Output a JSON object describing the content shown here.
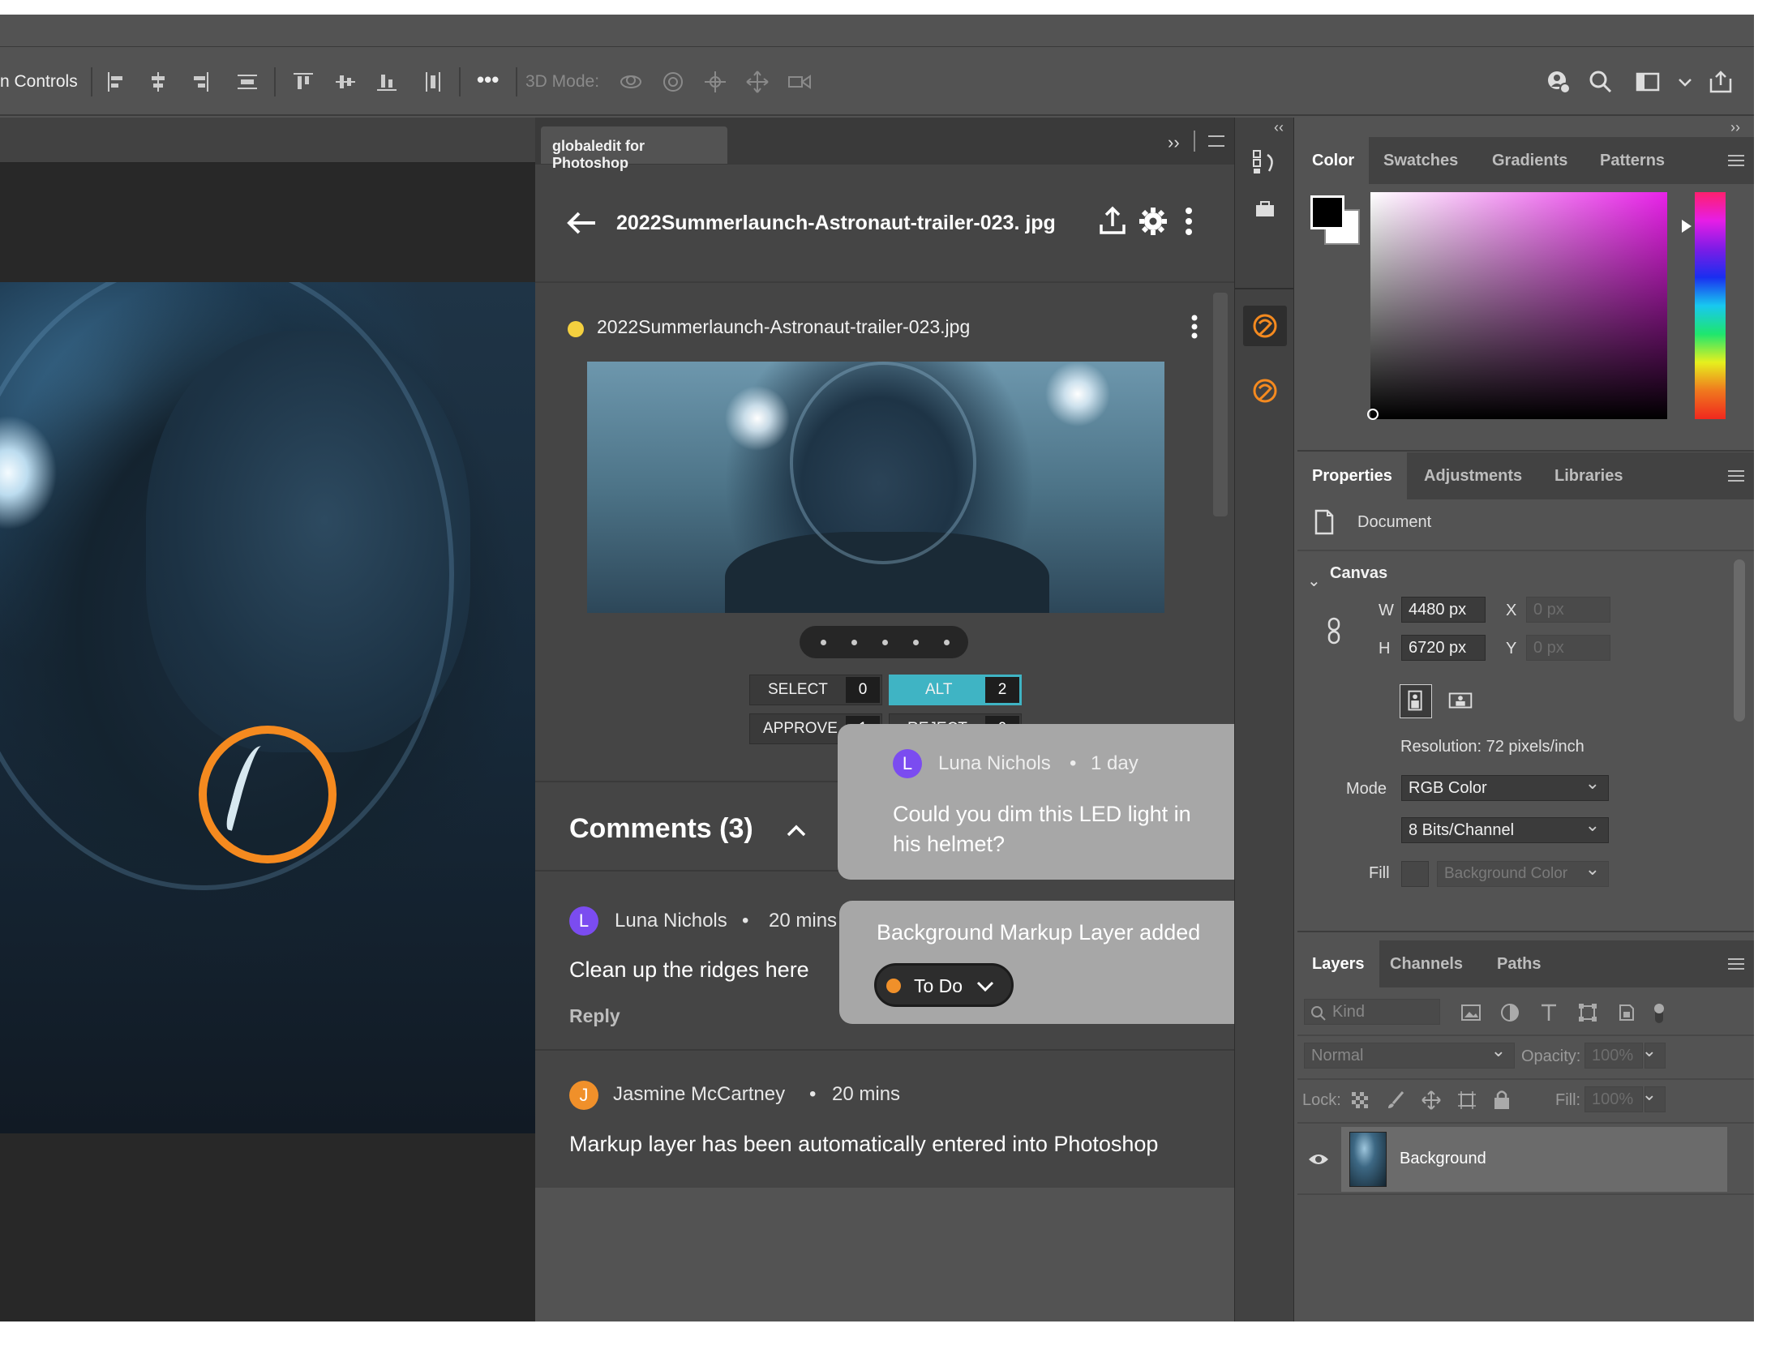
{
  "options_bar": {
    "controls_label": "n Controls",
    "mode_label": "3D Mode:",
    "more_label": "•••"
  },
  "plugin": {
    "tab_label": "globaledit for Photoshop",
    "header_title": "2022Summerlaunch-Astronaut-trailer-023. jpg",
    "file_name": "2022Summerlaunch-Astronaut-trailer-023.jpg",
    "tags": [
      {
        "label": "SELECT",
        "count": "0"
      },
      {
        "label": "ALT",
        "count": "2"
      },
      {
        "label": "APPROVE",
        "count": "1"
      },
      {
        "label": "REJECT",
        "count": "0"
      }
    ],
    "comments_title": "Comments (3)",
    "comments": [
      {
        "avatar": "L",
        "author": "Luna Nichols",
        "time": "20 mins",
        "body": "Clean up the ridges here",
        "reply": "Reply"
      },
      {
        "avatar": "J",
        "author": "Jasmine McCartney",
        "time": "20 mins",
        "body": "Markup layer has been automatically entered into Photoshop"
      }
    ]
  },
  "popover_comment": {
    "avatar": "L",
    "author": "Luna Nichols",
    "time": "1 day",
    "body_line1": "Could you dim this LED light in",
    "body_line2": "his helmet?"
  },
  "popover_markup": {
    "title": "Background Markup Layer added",
    "status": "To Do"
  },
  "color_panel": {
    "tabs": [
      "Color",
      "Swatches",
      "Gradients",
      "Patterns"
    ]
  },
  "properties_panel": {
    "tabs": [
      "Properties",
      "Adjustments",
      "Libraries"
    ],
    "doc_label": "Document",
    "canvas_label": "Canvas",
    "w_label": "W",
    "w_value": "4480 px",
    "h_label": "H",
    "h_value": "6720 px",
    "x_label": "X",
    "x_value": "0 px",
    "y_label": "Y",
    "y_value": "0 px",
    "resolution": "Resolution: 72 pixels/inch",
    "mode_label": "Mode",
    "mode_value": "RGB Color",
    "bits_value": "8 Bits/Channel",
    "fill_label": "Fill",
    "fill_value": "Background Color"
  },
  "layers_panel": {
    "tabs": [
      "Layers",
      "Channels",
      "Paths"
    ],
    "kind_placeholder": "Kind",
    "blend_mode": "Normal",
    "opacity_label": "Opacity:",
    "opacity_value": "100%",
    "lock_label": "Lock:",
    "fill_label": "Fill:",
    "fill_value": "100%",
    "layer_name": "Background"
  },
  "colors": {
    "accent_orange": "#f58a1f",
    "alt_teal": "#3fb4c4",
    "avatar_purple": "#7b4cf0",
    "avatar_orange": "#f0902a",
    "file_dot_yellow": "#f4d03f"
  }
}
